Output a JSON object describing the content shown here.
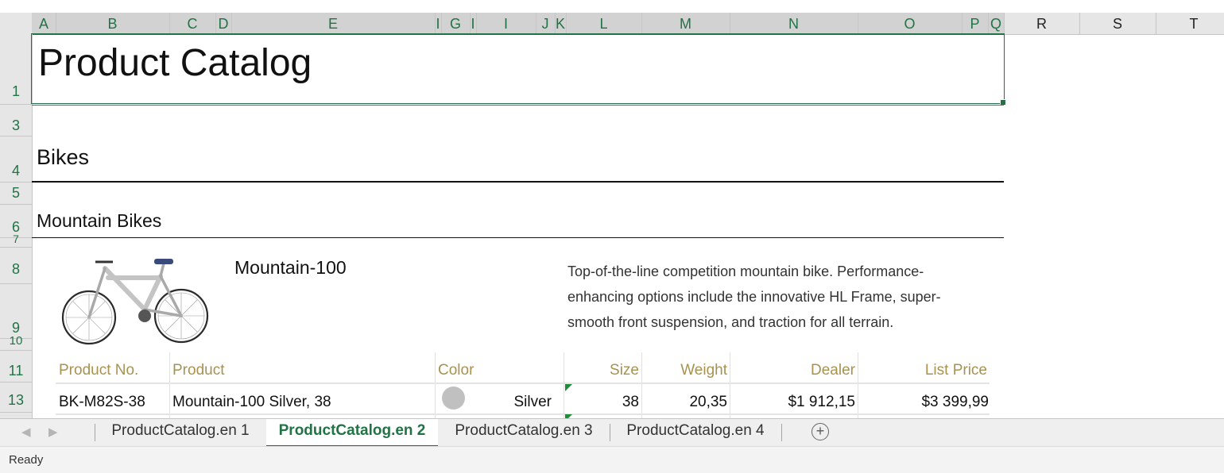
{
  "columns": {
    "A": "A",
    "B": "B",
    "C": "C",
    "D": "D",
    "E": "E",
    "I1": "I",
    "G": "G",
    "I2": "I",
    "I3": "I",
    "J": "J",
    "K": "K",
    "L": "L",
    "M": "M",
    "N": "N",
    "O": "O",
    "P": "P",
    "Q": "Q",
    "R": "R",
    "S": "S",
    "T": "T"
  },
  "rows": {
    "r1": "1",
    "r3": "3",
    "r4": "4",
    "r5": "5",
    "r6": "6",
    "r7": "7",
    "r8": "8",
    "r9": "9",
    "r10": "10",
    "r11": "11",
    "r13": "13"
  },
  "sheet": {
    "title": "Product Catalog",
    "category": "Bikes",
    "subcategory": "Mountain Bikes",
    "product_name": "Mountain-100",
    "description_line1": "Top-of-the-line competition mountain bike. Performance-",
    "description_line2": "enhancing options include the innovative HL Frame, super-",
    "description_line3": "smooth front suspension, and traction for all terrain.",
    "table": {
      "headers": {
        "product_no": "Product No.",
        "product": "Product",
        "color": "Color",
        "size": "Size",
        "weight": "Weight",
        "dealer": "Dealer",
        "list_price": "List Price"
      },
      "rows": [
        {
          "product_no": "BK-M82S-38",
          "product": "Mountain-100 Silver, 38",
          "color": "Silver",
          "size": "38",
          "weight": "20,35",
          "dealer": "$1 912,15",
          "list_price": "$3 399,99"
        }
      ]
    },
    "swatch_color": "#c0c0c0"
  },
  "tabs": [
    {
      "label": "ProductCatalog.en 1",
      "active": false
    },
    {
      "label": "ProductCatalog.en 2",
      "active": true
    },
    {
      "label": "ProductCatalog.en 3",
      "active": false
    },
    {
      "label": "ProductCatalog.en 4",
      "active": false
    }
  ],
  "add_sheet_label": "+",
  "status": "Ready",
  "colors": {
    "accent": "#217346",
    "header_text": "#a89250"
  }
}
